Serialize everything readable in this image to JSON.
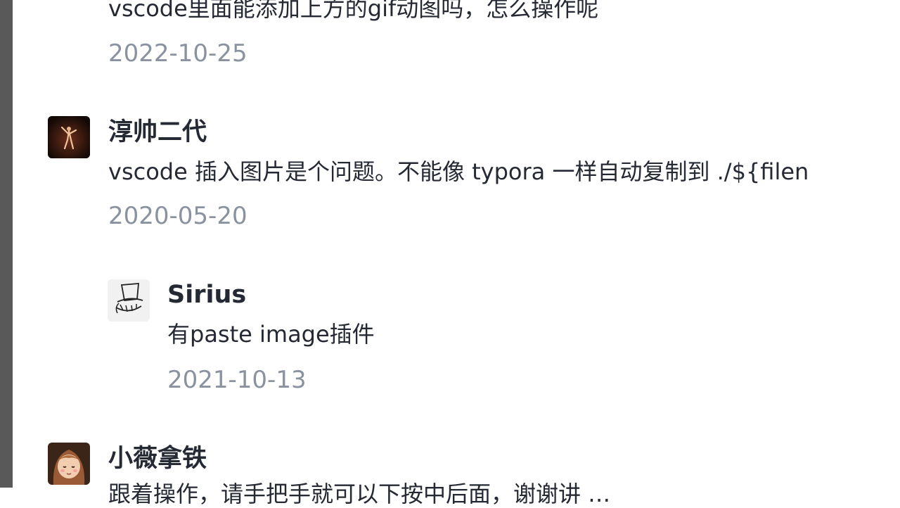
{
  "comments": [
    {
      "text": "vscode里面能添加上方的gif动图吗，怎么操作呢",
      "date": "2022-10-25"
    },
    {
      "author": "淳帅二代",
      "avatar_icon": "dancer-avatar",
      "text": "vscode 插入图片是个问题。不能像 typora 一样自动复制到 ./${filen",
      "date": "2020-05-20",
      "replies": [
        {
          "author": "Sirius",
          "avatar_icon": "top-hat-sketch-avatar",
          "text": "有paste image插件",
          "date": "2021-10-13"
        }
      ]
    },
    {
      "author": "小薇拿铁",
      "avatar_icon": "cartoon-girl-avatar",
      "text": "跟着操作，请手把手就可以下按中后面，谢谢讲 …"
    }
  ]
}
